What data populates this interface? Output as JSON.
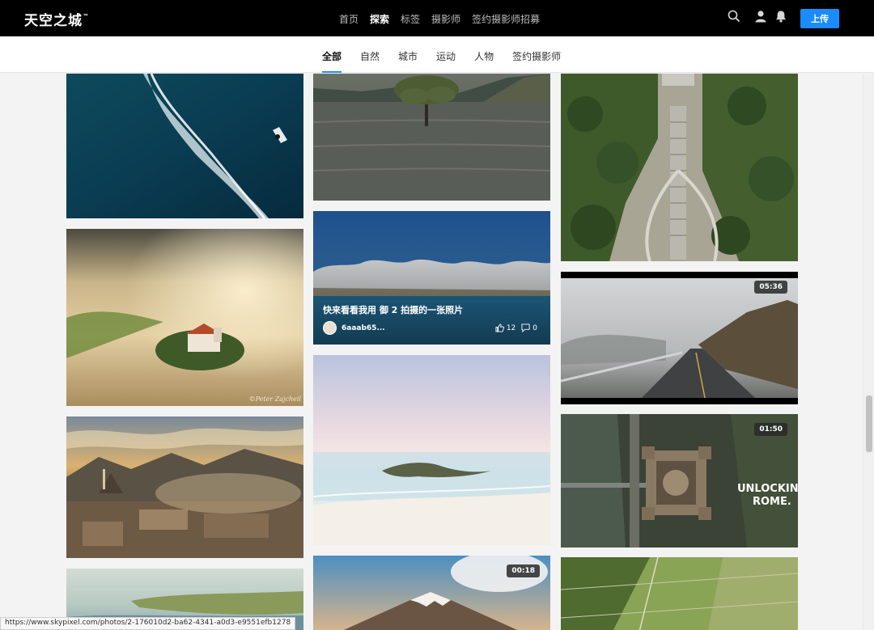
{
  "header": {
    "logo_text": "天空之城",
    "logo_tm": "™",
    "nav": [
      {
        "label": "首页",
        "active": false
      },
      {
        "label": "探索",
        "active": true
      },
      {
        "label": "标签",
        "active": false
      },
      {
        "label": "摄影师",
        "active": false
      },
      {
        "label": "签约摄影师招募",
        "active": false
      }
    ],
    "icons": [
      "search-icon",
      "user-icon",
      "bell-icon"
    ],
    "upload_label": "上传"
  },
  "subnav": {
    "items": [
      {
        "label": "全部",
        "active": true
      },
      {
        "label": "自然",
        "active": false
      },
      {
        "label": "城市",
        "active": false
      },
      {
        "label": "运动",
        "active": false
      },
      {
        "label": "人物",
        "active": false
      },
      {
        "label": "签约摄影师",
        "active": false
      }
    ]
  },
  "gallery": {
    "tiles": [
      {
        "id": "c1-1",
        "scene": "ocean-boat-wake"
      },
      {
        "id": "c1-2",
        "scene": "foggy-castle-sunrise"
      },
      {
        "id": "c1-3",
        "scene": "mountain-city-sunlight"
      },
      {
        "id": "c1-4",
        "scene": "coastline-aerial"
      },
      {
        "id": "c2-1",
        "scene": "lake-tree"
      },
      {
        "id": "c2-2",
        "scene": "lake-clouds",
        "title": "快来看看我用 御 2 拍摄的一张照片",
        "user": "6aaab65...",
        "likes": "12",
        "comments": "0"
      },
      {
        "id": "c2-3",
        "scene": "beach-island-pastel"
      },
      {
        "id": "c2-4",
        "scene": "volcano-mountain",
        "duration": "00:18"
      },
      {
        "id": "c3-1",
        "scene": "forest-stairs-aerial"
      },
      {
        "id": "c3-2",
        "scene": "foggy-road",
        "duration": "05:36"
      },
      {
        "id": "c3-3",
        "scene": "castle-rome-aerial",
        "duration": "01:50",
        "overlay_text": [
          "UNLOCKING",
          "ROME."
        ]
      },
      {
        "id": "c3-4",
        "scene": "farmland-aerial"
      }
    ],
    "watermark": "©Peter Zajcheil"
  },
  "status_url": "https://www.skypixel.com/photos/2-176010d2-ba62-4341-a0d3-e9551efb1278"
}
